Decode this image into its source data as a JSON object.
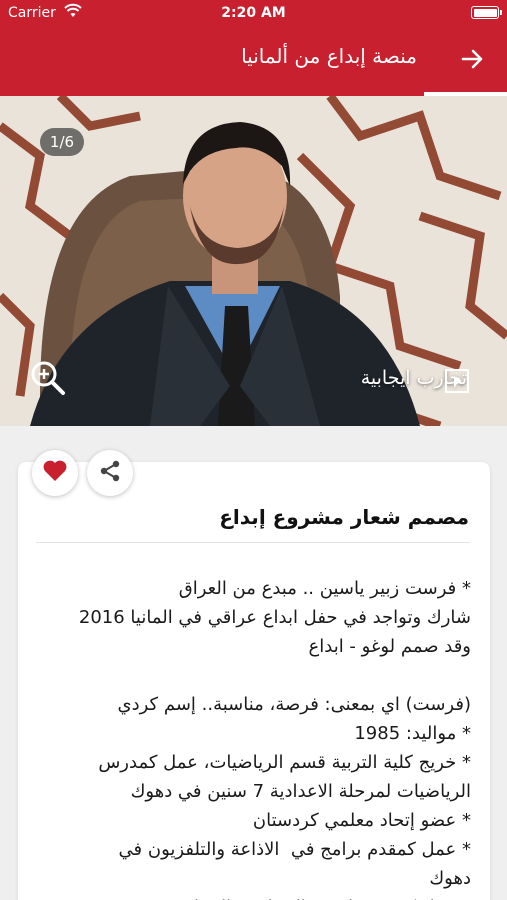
{
  "status": {
    "carrier": "Carrier",
    "time": "2:20 AM"
  },
  "header": {
    "title": "منصة إبداع من ألمانيا"
  },
  "hero": {
    "counter": "1/6",
    "caption": "تجارب ايجابية"
  },
  "post": {
    "title": "مصمم شعار مشروع إبداع",
    "body": "* فرست زبير ياسين .. مبدع من العراق\nشارك وتواجد في حفل ابداع عراقي في المانيا 2016\nوقد صمم لوغو - ابداع\n\n(فرست) اي بمعنى: فرصة، مناسبة.. إسم كردي\n* مواليد: 1985\n* خريج كلية التربية قسم الرياضيات، عمل كمدرس\nالرياضيات لمرحلة الاعدادية 7 سنين في دهوك\n* عضو إتحاد معلمي كردستان\n* عمل كمقدم برامج في  الاذاعة والتلفزيون في\nدهوك\n* عمل كمصمم لبعض المجلات والجرائد في"
  },
  "icons": [
    "wifi-icon",
    "battery-icon",
    "back-arrow-icon",
    "zoom-in-icon",
    "video-icon",
    "heart-icon",
    "share-icon"
  ],
  "colors": {
    "brand": "#c8202f",
    "heart": "#c8202f"
  }
}
